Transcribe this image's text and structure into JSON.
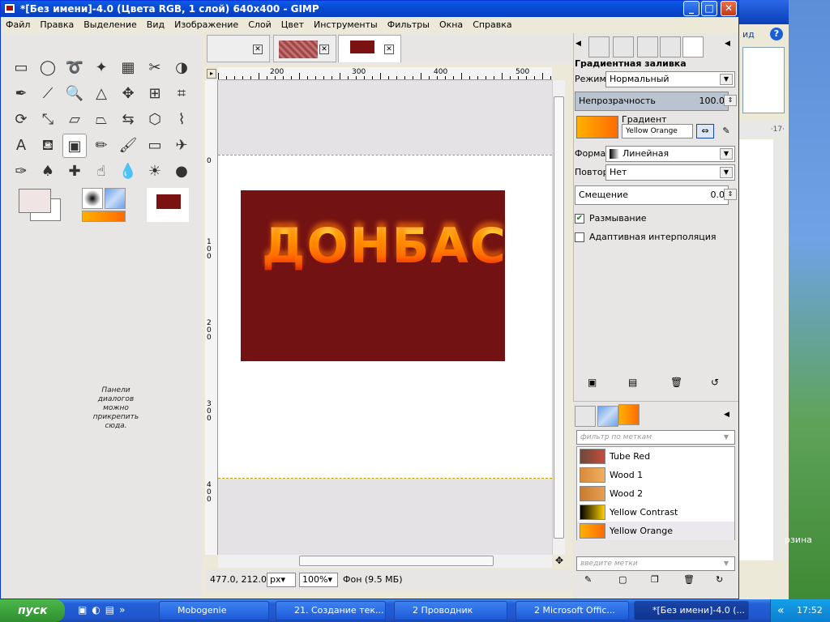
{
  "window": {
    "title": "*[Без имени]-4.0 (Цвета RGB, 1 слой) 640x400 - GIMP"
  },
  "menu": [
    "Файл",
    "Правка",
    "Выделение",
    "Вид",
    "Изображение",
    "Слой",
    "Цвет",
    "Инструменты",
    "Фильтры",
    "Окна",
    "Справка"
  ],
  "toolbox": {
    "tools": [
      "rect-select",
      "ellipse-select",
      "free-select",
      "fuzzy-select",
      "color-select",
      "scissors",
      "foreground-select",
      "paths",
      "color-picker",
      "zoom",
      "measure",
      "move",
      "align",
      "crop",
      "rotate",
      "scale",
      "shear",
      "perspective",
      "flip",
      "cage",
      "warp",
      "text",
      "bucket-fill",
      "blend",
      "pencil",
      "paintbrush",
      "eraser",
      "airbrush",
      "ink",
      "clone",
      "heal",
      "smudge",
      "blur",
      "dodge-burn",
      "dodge"
    ],
    "dock_hint": "Панели диалогов можно прикрепить сюда."
  },
  "ruler": {
    "top": [
      "200",
      "300",
      "400",
      "500"
    ],
    "left": [
      "0",
      "1 0 0",
      "2 0 0",
      "3 0 0",
      "4 0 0"
    ]
  },
  "image": {
    "text": "ДОНБАС",
    "bg_color": "#731212"
  },
  "status": {
    "coords": "477.0, 212.0",
    "unit": "px",
    "zoom": "100%",
    "info": "Фон (9.5 МБ)"
  },
  "tool_options": {
    "heading": "Градиентная заливка",
    "mode_label": "Режим:",
    "mode_value": "Нормальный",
    "opacity_label": "Непрозрачность",
    "opacity_value": "100.0",
    "gradient_label": "Градиент",
    "gradient_value": "Yellow Orange",
    "shape_label": "Форма:",
    "shape_value": "Линейная",
    "repeat_label": "Повтор:",
    "repeat_value": "Нет",
    "offset_label": "Смещение",
    "offset_value": "0.0",
    "dither_label": "Размывание",
    "dither_checked": true,
    "adaptive_label": "Адаптивная интерполяция",
    "adaptive_checked": false
  },
  "gradients": {
    "filter_placeholder": "фильтр по меткам",
    "tags_placeholder": "введите метки",
    "items": [
      {
        "name": "Tube Red",
        "colors": [
          "#6a4a3a",
          "#c84a3a"
        ]
      },
      {
        "name": "Wood 1",
        "colors": [
          "#d88a3a",
          "#f0b060"
        ]
      },
      {
        "name": "Wood 2",
        "colors": [
          "#c87a30",
          "#e8a050"
        ]
      },
      {
        "name": "Yellow Contrast",
        "colors": [
          "#000000",
          "#ffd000"
        ]
      },
      {
        "name": "Yellow Orange",
        "colors": [
          "#ffb000",
          "#ff6a00"
        ]
      }
    ]
  },
  "background_window": {
    "link": "ид",
    "page": "·17·",
    "trash": "рзина"
  },
  "taskbar": {
    "start": "пуск",
    "tasks": [
      "Mobogenie",
      "21. Создание тек...",
      "2 Проводник",
      "2 Microsoft Offic...",
      "*[Без имени]-4.0 (..."
    ],
    "clock": "17:52"
  }
}
